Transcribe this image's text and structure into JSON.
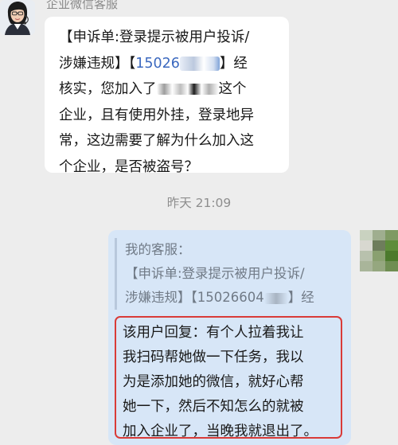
{
  "chat": {
    "sender_name": "企业微信客服",
    "incoming": {
      "line1": "【申诉单:登录提示被用户投诉/",
      "line2_prefix": "涉嫌违规】【",
      "line2_phone": "15026",
      "line2_suffix": "】经",
      "line3_prefix": "核实，您加入了",
      "line3_suffix": "这个",
      "line4": "企业，且有使用外挂，登录地异",
      "line5": "常，这边需要了解为什么加入这",
      "line6": "个企业，是否被盗号？"
    },
    "timestamp": "昨天  21:09",
    "outgoing": {
      "quote_line1": "我的客服：",
      "quote_line2": "【申诉单:登录提示被用户投诉/",
      "quote_line3_prefix": "涉嫌违规】【15026604",
      "quote_line3_suffix": "】经",
      "reply_line1": "该用户回复：有个人拉着我让",
      "reply_line2": "我扫码帮她做一下任务，我以",
      "reply_line3": "为是添加她的微信，就好心帮",
      "reply_line4": "她一下，然后不知怎么的就被",
      "reply_line5": "加入企业了，当晚我就退出了。"
    }
  },
  "colors": {
    "background": "#ededed",
    "incoming_bubble": "#ffffff",
    "outgoing_bubble": "#d7e6f7",
    "highlight_border": "#d93b38",
    "link_blue": "#3c69bf"
  }
}
